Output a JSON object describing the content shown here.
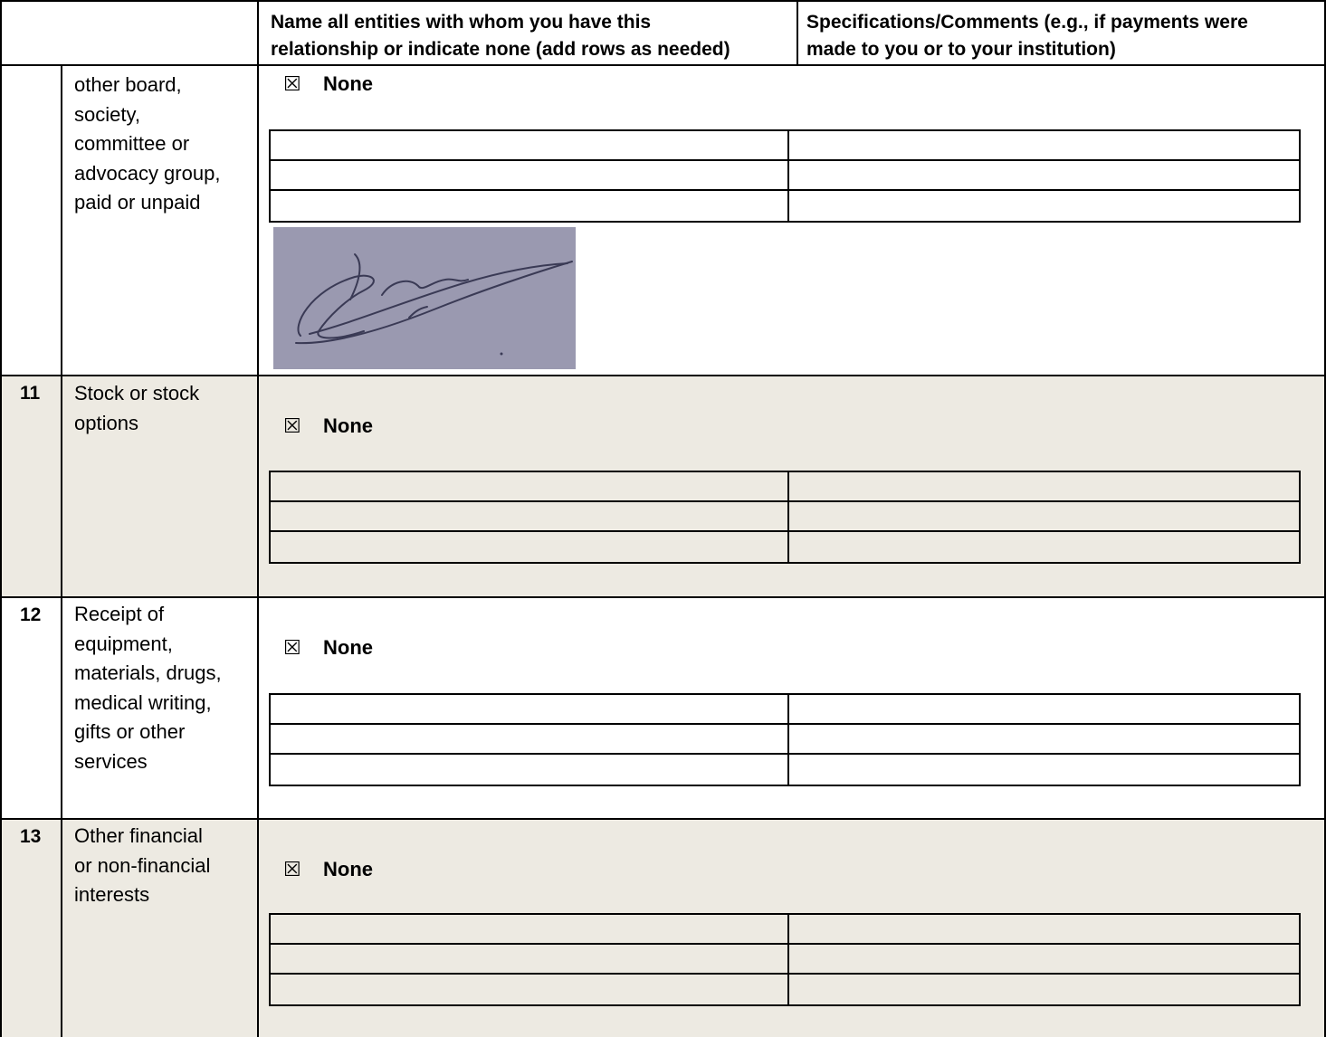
{
  "header": {
    "col_entities": "Name all entities with whom you have this relationship or indicate none (add rows as needed)",
    "col_entities_line1": "Name all entities with whom you have this",
    "col_entities_line2": "relationship or indicate none (add rows as needed)",
    "col_specs_line1": "Specifications/Comments (e.g., if payments were",
    "col_specs_line2": "made to you or to your institution)"
  },
  "checkbox_symbol": "☒",
  "rows": [
    {
      "number": "",
      "label_lines": [
        "other board,",
        "society,",
        "committee or",
        "advocacy group,",
        "paid or unpaid"
      ],
      "checked": true,
      "none_label": "None",
      "has_signature": true,
      "signature_text": ""
    },
    {
      "number": "11",
      "label_lines": [
        "Stock or stock",
        "options"
      ],
      "checked": true,
      "none_label": "None"
    },
    {
      "number": "12",
      "label_lines": [
        "Receipt of",
        "equipment,",
        "materials, drugs,",
        "medical writing,",
        "gifts or other",
        "services"
      ],
      "checked": true,
      "none_label": "None"
    },
    {
      "number": "13",
      "label_lines": [
        "Other financial",
        "or non-financial",
        "interests"
      ],
      "checked": true,
      "none_label": "None"
    }
  ]
}
